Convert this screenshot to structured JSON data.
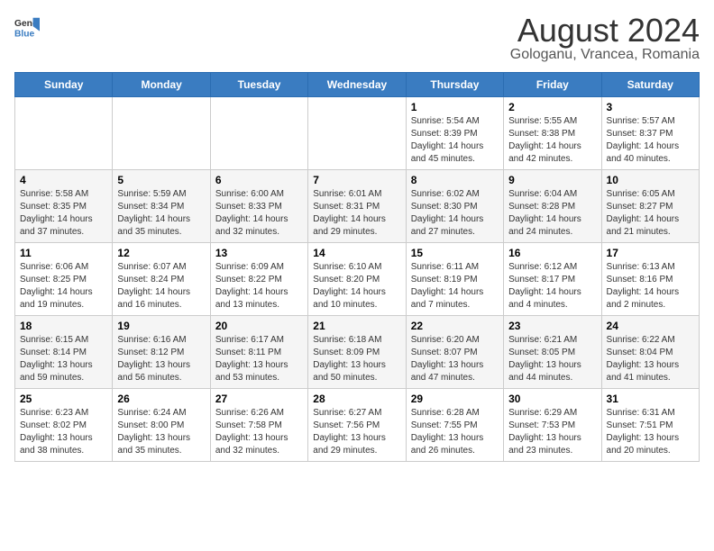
{
  "header": {
    "logo_general": "General",
    "logo_blue": "Blue",
    "title": "August 2024",
    "subtitle": "Gologanu, Vrancea, Romania"
  },
  "weekdays": [
    "Sunday",
    "Monday",
    "Tuesday",
    "Wednesday",
    "Thursday",
    "Friday",
    "Saturday"
  ],
  "weeks": [
    [
      {
        "day": "",
        "detail": ""
      },
      {
        "day": "",
        "detail": ""
      },
      {
        "day": "",
        "detail": ""
      },
      {
        "day": "",
        "detail": ""
      },
      {
        "day": "1",
        "detail": "Sunrise: 5:54 AM\nSunset: 8:39 PM\nDaylight: 14 hours\nand 45 minutes."
      },
      {
        "day": "2",
        "detail": "Sunrise: 5:55 AM\nSunset: 8:38 PM\nDaylight: 14 hours\nand 42 minutes."
      },
      {
        "day": "3",
        "detail": "Sunrise: 5:57 AM\nSunset: 8:37 PM\nDaylight: 14 hours\nand 40 minutes."
      }
    ],
    [
      {
        "day": "4",
        "detail": "Sunrise: 5:58 AM\nSunset: 8:35 PM\nDaylight: 14 hours\nand 37 minutes."
      },
      {
        "day": "5",
        "detail": "Sunrise: 5:59 AM\nSunset: 8:34 PM\nDaylight: 14 hours\nand 35 minutes."
      },
      {
        "day": "6",
        "detail": "Sunrise: 6:00 AM\nSunset: 8:33 PM\nDaylight: 14 hours\nand 32 minutes."
      },
      {
        "day": "7",
        "detail": "Sunrise: 6:01 AM\nSunset: 8:31 PM\nDaylight: 14 hours\nand 29 minutes."
      },
      {
        "day": "8",
        "detail": "Sunrise: 6:02 AM\nSunset: 8:30 PM\nDaylight: 14 hours\nand 27 minutes."
      },
      {
        "day": "9",
        "detail": "Sunrise: 6:04 AM\nSunset: 8:28 PM\nDaylight: 14 hours\nand 24 minutes."
      },
      {
        "day": "10",
        "detail": "Sunrise: 6:05 AM\nSunset: 8:27 PM\nDaylight: 14 hours\nand 21 minutes."
      }
    ],
    [
      {
        "day": "11",
        "detail": "Sunrise: 6:06 AM\nSunset: 8:25 PM\nDaylight: 14 hours\nand 19 minutes."
      },
      {
        "day": "12",
        "detail": "Sunrise: 6:07 AM\nSunset: 8:24 PM\nDaylight: 14 hours\nand 16 minutes."
      },
      {
        "day": "13",
        "detail": "Sunrise: 6:09 AM\nSunset: 8:22 PM\nDaylight: 14 hours\nand 13 minutes."
      },
      {
        "day": "14",
        "detail": "Sunrise: 6:10 AM\nSunset: 8:20 PM\nDaylight: 14 hours\nand 10 minutes."
      },
      {
        "day": "15",
        "detail": "Sunrise: 6:11 AM\nSunset: 8:19 PM\nDaylight: 14 hours\nand 7 minutes."
      },
      {
        "day": "16",
        "detail": "Sunrise: 6:12 AM\nSunset: 8:17 PM\nDaylight: 14 hours\nand 4 minutes."
      },
      {
        "day": "17",
        "detail": "Sunrise: 6:13 AM\nSunset: 8:16 PM\nDaylight: 14 hours\nand 2 minutes."
      }
    ],
    [
      {
        "day": "18",
        "detail": "Sunrise: 6:15 AM\nSunset: 8:14 PM\nDaylight: 13 hours\nand 59 minutes."
      },
      {
        "day": "19",
        "detail": "Sunrise: 6:16 AM\nSunset: 8:12 PM\nDaylight: 13 hours\nand 56 minutes."
      },
      {
        "day": "20",
        "detail": "Sunrise: 6:17 AM\nSunset: 8:11 PM\nDaylight: 13 hours\nand 53 minutes."
      },
      {
        "day": "21",
        "detail": "Sunrise: 6:18 AM\nSunset: 8:09 PM\nDaylight: 13 hours\nand 50 minutes."
      },
      {
        "day": "22",
        "detail": "Sunrise: 6:20 AM\nSunset: 8:07 PM\nDaylight: 13 hours\nand 47 minutes."
      },
      {
        "day": "23",
        "detail": "Sunrise: 6:21 AM\nSunset: 8:05 PM\nDaylight: 13 hours\nand 44 minutes."
      },
      {
        "day": "24",
        "detail": "Sunrise: 6:22 AM\nSunset: 8:04 PM\nDaylight: 13 hours\nand 41 minutes."
      }
    ],
    [
      {
        "day": "25",
        "detail": "Sunrise: 6:23 AM\nSunset: 8:02 PM\nDaylight: 13 hours\nand 38 minutes."
      },
      {
        "day": "26",
        "detail": "Sunrise: 6:24 AM\nSunset: 8:00 PM\nDaylight: 13 hours\nand 35 minutes."
      },
      {
        "day": "27",
        "detail": "Sunrise: 6:26 AM\nSunset: 7:58 PM\nDaylight: 13 hours\nand 32 minutes."
      },
      {
        "day": "28",
        "detail": "Sunrise: 6:27 AM\nSunset: 7:56 PM\nDaylight: 13 hours\nand 29 minutes."
      },
      {
        "day": "29",
        "detail": "Sunrise: 6:28 AM\nSunset: 7:55 PM\nDaylight: 13 hours\nand 26 minutes."
      },
      {
        "day": "30",
        "detail": "Sunrise: 6:29 AM\nSunset: 7:53 PM\nDaylight: 13 hours\nand 23 minutes."
      },
      {
        "day": "31",
        "detail": "Sunrise: 6:31 AM\nSunset: 7:51 PM\nDaylight: 13 hours\nand 20 minutes."
      }
    ]
  ]
}
